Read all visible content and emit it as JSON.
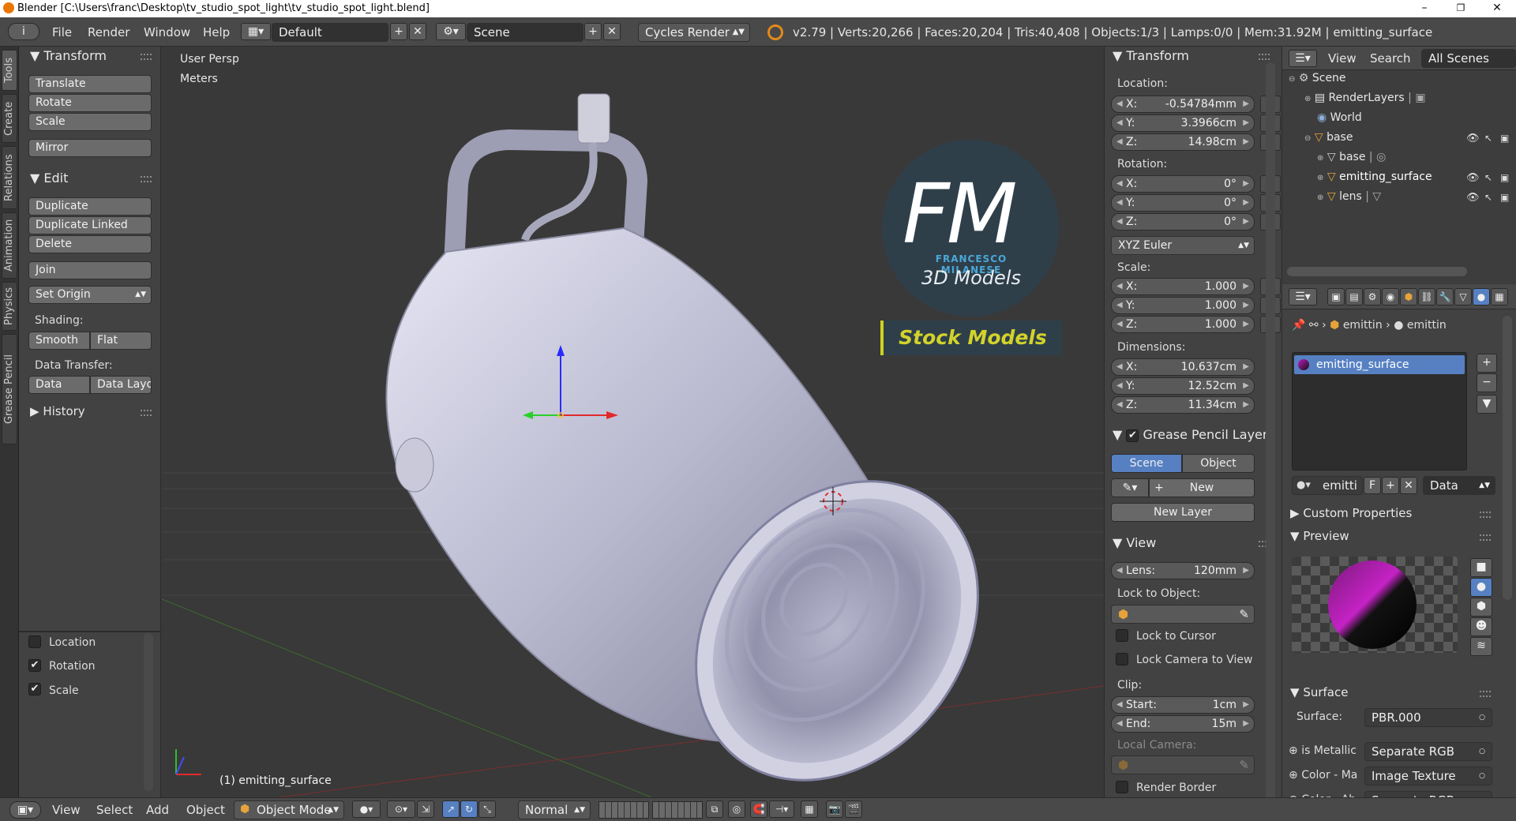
{
  "titlebar": {
    "title": "Blender [C:\\Users\\franc\\Desktop\\tv_studio_spot_light\\tv_studio_spot_light.blend]",
    "minimize": "–",
    "maximize": "❐",
    "close": "✕"
  },
  "menubar": {
    "info_icon": "i",
    "menus": [
      "File",
      "Render",
      "Window",
      "Help"
    ],
    "screen_layout": "Default",
    "scene": "Scene",
    "render_engine": "Cycles Render",
    "stats": "v2.79 | Verts:20,266 | Faces:20,204 | Tris:40,408 | Objects:1/3 | Lamps:0/0 | Mem:31.92M | emitting_surface"
  },
  "vertical_tabs": [
    "Tools",
    "Create",
    "Relations",
    "Animation",
    "Physics",
    "Grease Pencil"
  ],
  "toolshelf": {
    "transform_title": "Transform",
    "transform_buttons": [
      "Translate",
      "Rotate",
      "Scale"
    ],
    "mirror": "Mirror",
    "edit_title": "Edit",
    "edit_buttons": [
      "Duplicate",
      "Duplicate Linked",
      "Delete"
    ],
    "join": "Join",
    "set_origin": "Set Origin",
    "shading_label": "Shading:",
    "smooth": "Smooth",
    "flat": "Flat",
    "data_transfer_label": "Data Transfer:",
    "data": "Data",
    "data_layout": "Data Layo",
    "history_title": "History",
    "options": [
      {
        "label": "Location",
        "checked": false
      },
      {
        "label": "Rotation",
        "checked": true
      },
      {
        "label": "Scale",
        "checked": true
      }
    ]
  },
  "viewport": {
    "view_name": "User Persp",
    "units": "Meters",
    "object_label": "(1) emitting_surface",
    "logo_letters": "FM",
    "logo_name": "FRANCESCO MILANESE",
    "logo_sub": "3D Models",
    "logo_banner": "Stock Models"
  },
  "npanel": {
    "transform_title": "Transform",
    "location_label": "Location:",
    "location": [
      {
        "k": "X:",
        "v": "-0.54784mm"
      },
      {
        "k": "Y:",
        "v": "3.3966cm"
      },
      {
        "k": "Z:",
        "v": "14.98cm"
      }
    ],
    "rotation_label": "Rotation:",
    "rotation": [
      {
        "k": "X:",
        "v": "0°"
      },
      {
        "k": "Y:",
        "v": "0°"
      },
      {
        "k": "Z:",
        "v": "0°"
      }
    ],
    "rotation_mode": "XYZ Euler",
    "scale_label": "Scale:",
    "scale": [
      {
        "k": "X:",
        "v": "1.000"
      },
      {
        "k": "Y:",
        "v": "1.000"
      },
      {
        "k": "Z:",
        "v": "1.000"
      }
    ],
    "dimensions_label": "Dimensions:",
    "dimensions": [
      {
        "k": "X:",
        "v": "10.637cm"
      },
      {
        "k": "Y:",
        "v": "12.52cm"
      },
      {
        "k": "Z:",
        "v": "11.34cm"
      }
    ],
    "grease_title": "Grease Pencil Layer",
    "scene_tab": "Scene",
    "object_tab": "Object",
    "new": "New",
    "new_layer": "New Layer",
    "view_title": "View",
    "lens_label": "Lens:",
    "lens_value": "120mm",
    "lock_to_object": "Lock to Object:",
    "lock_to_cursor": "Lock to Cursor",
    "lock_camera": "Lock Camera to View",
    "clip_label": "Clip:",
    "clip_start_k": "Start:",
    "clip_start_v": "1cm",
    "clip_end_k": "End:",
    "clip_end_v": "15m",
    "local_camera": "Local Camera:",
    "render_border": "Render Border"
  },
  "outliner": {
    "view": "View",
    "search": "Search",
    "all_scenes": "All Scenes",
    "items": [
      {
        "label": "Scene",
        "level": 0
      },
      {
        "label": "RenderLayers",
        "level": 1
      },
      {
        "label": "World",
        "level": 1
      },
      {
        "label": "base",
        "level": 1
      },
      {
        "label": "base",
        "level": 2
      },
      {
        "label": "emitting_surface",
        "level": 2
      },
      {
        "label": "lens",
        "level": 2
      }
    ]
  },
  "properties": {
    "breadcrumb_obj": "emittin",
    "breadcrumb_mat": "emittin",
    "material_slot": "emitting_surface",
    "mat_name": "emitti",
    "mat_f": "F",
    "link_data": "Data",
    "custom_props": "Custom Properties",
    "preview": "Preview",
    "surface_title": "Surface",
    "surface_label": "Surface:",
    "surface_value": "PBR.000",
    "inputs": [
      {
        "label": "is Metallic",
        "value": "Separate RGB"
      },
      {
        "label": "Color - Ma",
        "value": "Image Texture"
      },
      {
        "label": "Color - Ab",
        "value": "Separate RGB"
      }
    ]
  },
  "bottombar": {
    "menus": [
      "View",
      "Select",
      "Add",
      "Object"
    ],
    "mode": "Object Mode",
    "orientation": "Normal"
  }
}
